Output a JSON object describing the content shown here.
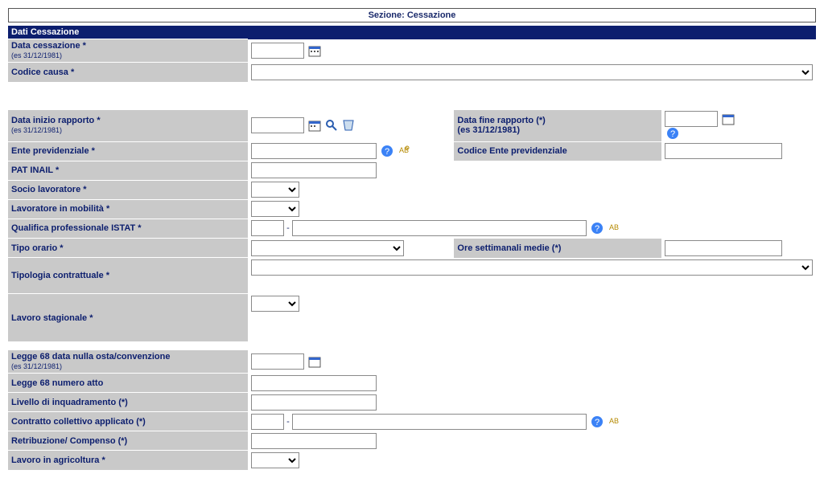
{
  "section": {
    "title": "Sezione: Cessazione"
  },
  "header1": "Dati Cessazione",
  "labels": {
    "data_cessazione": "Data cessazione *",
    "hint_date": "(es 31/12/1981)",
    "codice_causa": "Codice causa *",
    "data_inizio": "Data inizio rapporto *",
    "data_fine": "Data fine rapporto (*)",
    "ente_prev": "Ente previdenziale *",
    "codice_ente_prev": "Codice Ente previdenziale",
    "pat_inail": "PAT INAIL *",
    "socio": "Socio lavoratore *",
    "mobilita": "Lavoratore in mobilità *",
    "qualifica": "Qualifica professionale ISTAT *",
    "tipo_orario": "Tipo orario *",
    "ore_sett": "Ore settimanali medie (*)",
    "tipologia": "Tipologia contrattuale *",
    "stagionale": "Lavoro stagionale *",
    "legge68_data": "Legge 68 data nulla osta/convenzione",
    "legge68_num": "Legge 68 numero atto",
    "livello": "Livello di inquadramento (*)",
    "contratto": "Contratto collettivo applicato (*)",
    "retribuzione": "Retribuzione/ Compenso (*)",
    "agricoltura": "Lavoro in agricoltura *"
  },
  "icons": {
    "calendar": "calendar-icon",
    "search": "search-icon",
    "clear": "clear-icon",
    "help": "help-icon",
    "spell": "spell-icon"
  }
}
